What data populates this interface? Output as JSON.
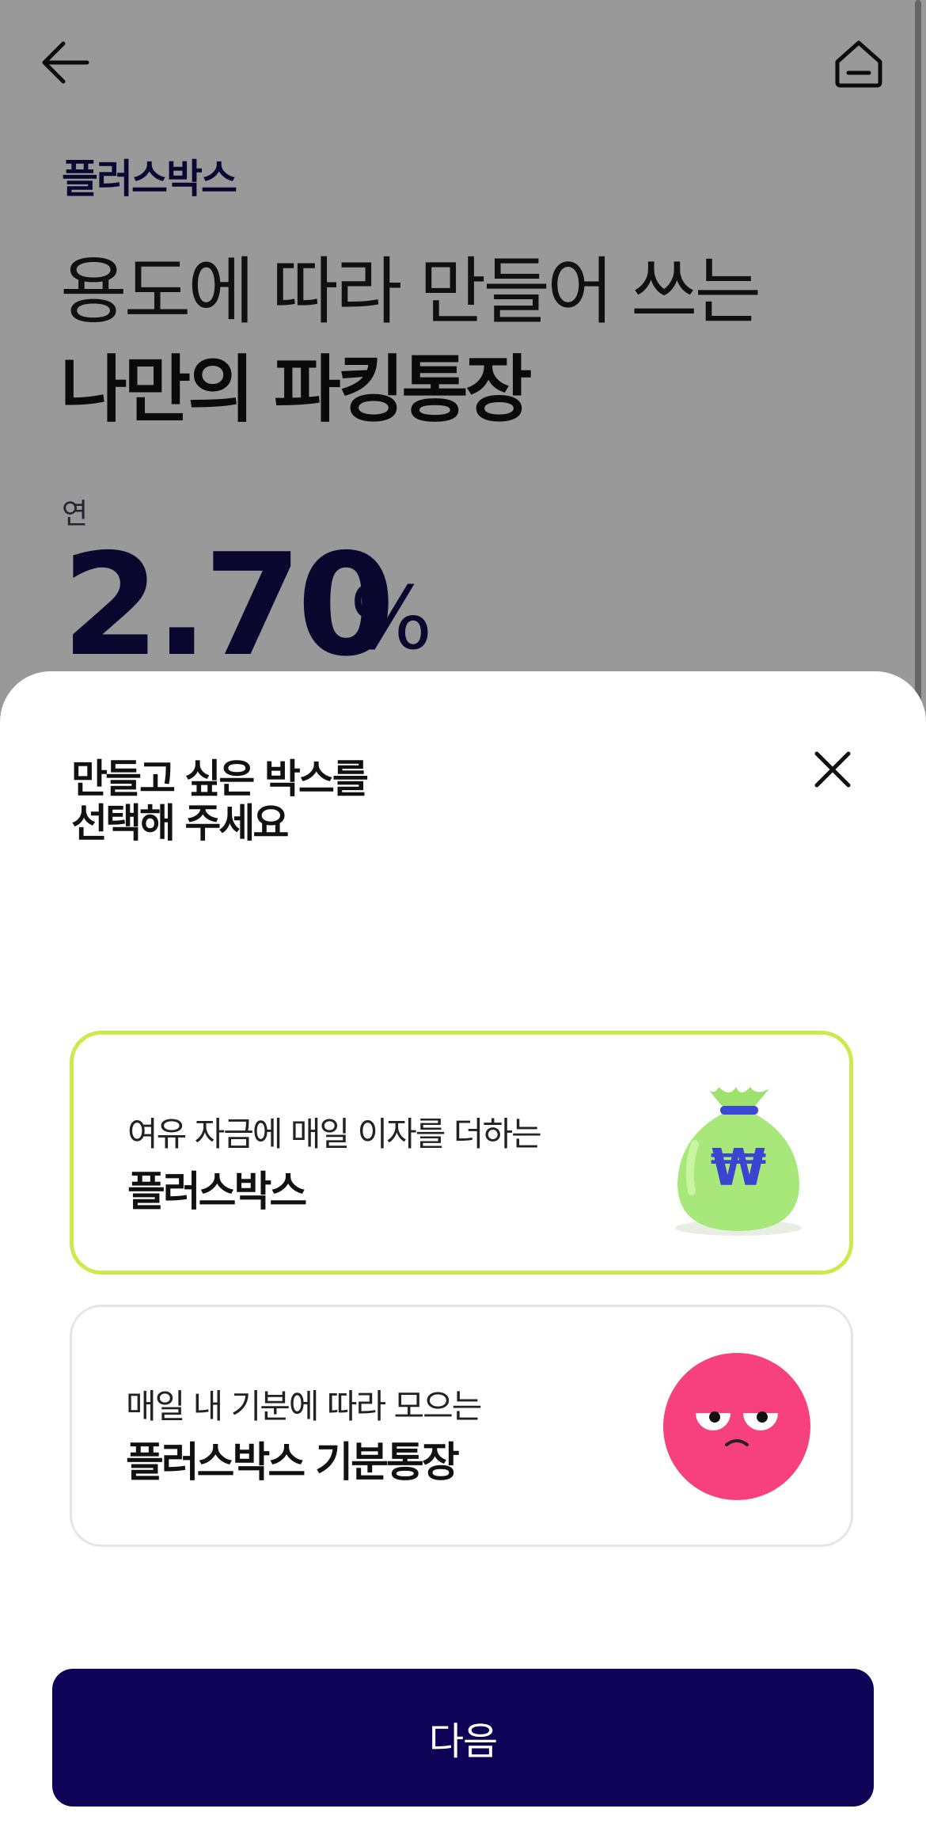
{
  "header": {
    "back_icon": "arrow-left-icon",
    "home_icon": "home-icon"
  },
  "product": {
    "eyebrow": "플러스박스",
    "headline_line1": "용도에 따라 만들어 쓰는",
    "headline_line2": "나만의 파킹통장",
    "rate_label": "연",
    "rate_value": "2.70",
    "rate_unit": "%"
  },
  "sheet": {
    "title_line1": "만들고 싶은 박스를",
    "title_line2": "선택해 주세요",
    "close_icon": "close-icon",
    "options": [
      {
        "description": "여유 자금에 매일 이자를 더하는",
        "name": "플러스박스",
        "icon": "money-bag-icon",
        "selected": true
      },
      {
        "description": "매일 내 기분에 따라 모으는",
        "name": "플러스박스 기분통장",
        "icon": "mood-face-icon",
        "selected": false
      }
    ]
  },
  "footer": {
    "next_label": "다음"
  },
  "colors": {
    "brand_navy": "#0f0357",
    "selected_border": "#cdea4d",
    "bag_green": "#9ee26e",
    "mood_pink": "#f7417e",
    "overlay": "rgba(0,0,0,0.4)"
  }
}
